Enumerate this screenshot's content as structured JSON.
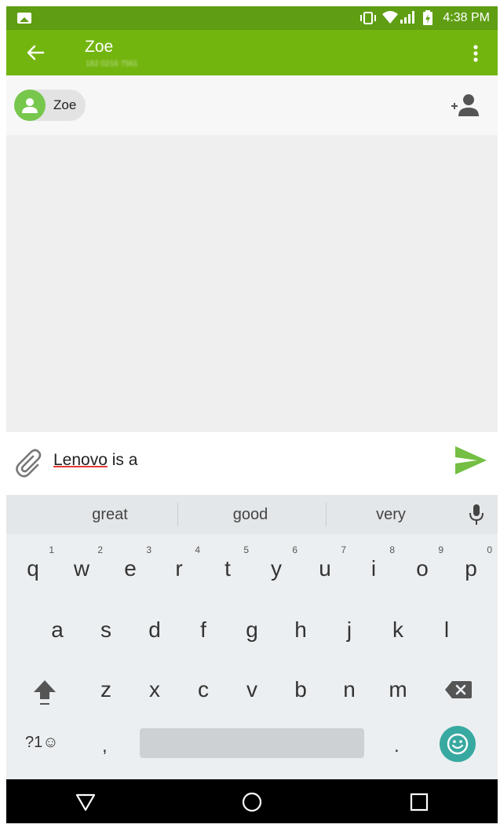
{
  "status_bar": {
    "time": "4:38 PM"
  },
  "app_bar": {
    "title": "Zoe",
    "subtitle": "182 0216 7561"
  },
  "recipients": {
    "chip_name": "Zoe"
  },
  "compose": {
    "misspelled_word": "Lenovo",
    "rest_text": " is a"
  },
  "keyboard": {
    "suggestions": [
      "great",
      "good",
      "very"
    ],
    "row1": [
      {
        "key": "q",
        "hint": "1"
      },
      {
        "key": "w",
        "hint": "2"
      },
      {
        "key": "e",
        "hint": "3"
      },
      {
        "key": "r",
        "hint": "4"
      },
      {
        "key": "t",
        "hint": "5"
      },
      {
        "key": "y",
        "hint": "6"
      },
      {
        "key": "u",
        "hint": "7"
      },
      {
        "key": "i",
        "hint": "8"
      },
      {
        "key": "o",
        "hint": "9"
      },
      {
        "key": "p",
        "hint": "0"
      }
    ],
    "row2": [
      "a",
      "s",
      "d",
      "f",
      "g",
      "h",
      "j",
      "k",
      "l"
    ],
    "row3": [
      "z",
      "x",
      "c",
      "v",
      "b",
      "n",
      "m"
    ],
    "symbols_key": "?1☺",
    "comma_key": ",",
    "period_key": "."
  },
  "colors": {
    "status_bar": "#5f9e13",
    "app_bar": "#73b50f",
    "send": "#74bf43",
    "avatar": "#77c74d",
    "emoji_button": "#38a9a0",
    "misspell_underline": "#e53935"
  }
}
